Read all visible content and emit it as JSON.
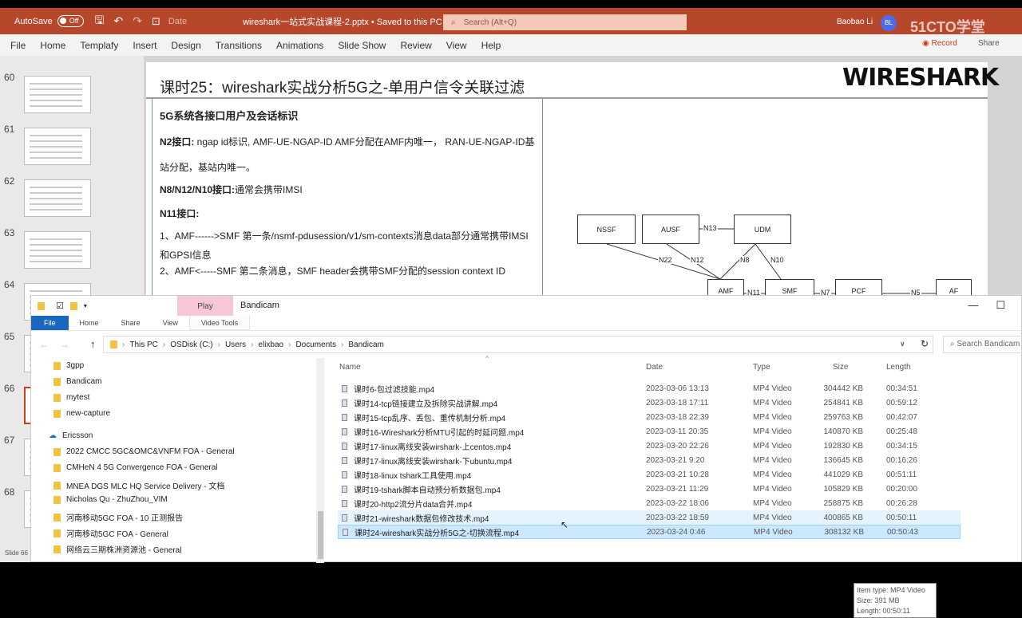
{
  "titlebar": {
    "autosave": "AutoSave",
    "toggle": "Off",
    "date_label": "Date",
    "doc_title": "wireshark一站式实战课程-2.pptx • Saved to this PC ∨",
    "search_placeholder": "Search (Alt+Q)",
    "user": "Baobao Li",
    "initials": "BL",
    "watermark": "51CTO学堂"
  },
  "ribbon": {
    "tabs": [
      "File",
      "Home",
      "Templafy",
      "Insert",
      "Design",
      "Transitions",
      "Animations",
      "Slide Show",
      "Review",
      "View",
      "Help"
    ],
    "record": "Record",
    "share": "Share"
  },
  "thumbnails": {
    "numbers": [
      "60",
      "61",
      "62",
      "63",
      "64",
      "65",
      "66",
      "67",
      "68"
    ],
    "selected": "66"
  },
  "slide": {
    "title": "课时25：wireshark实战分析5G之-单用户信令关联过滤",
    "logo": "WIRESHARK",
    "heading": "5G系统各接口用户及会话标识",
    "p1_bold": "N2接口:",
    "p1": " ngap id标识, AMF-UE-NGAP-ID AMF分配在AMF内唯一， RAN-UE-NGAP-ID基站分配，基站内唯一。",
    "p2_bold": "N8/N12/N10接口:",
    "p2": "通常会携带IMSI",
    "p3_bold": "N11接口:",
    "p4": "1、AMF------>SMF 第一条/nsmf-pdusession/v1/sm-contexts消息data部分通常携带IMSI和GPSI信息",
    "p5": "2、AMF<-----SMF 第二条消息，SMF header会携带SMF分配的session context ID",
    "diagram": {
      "nodes": [
        "NSSF",
        "AUSF",
        "UDM",
        "AMF",
        "SMF",
        "PCF",
        "AF"
      ],
      "links": [
        "N13",
        "N22",
        "N12",
        "N8",
        "N10",
        "N11",
        "N7",
        "N5"
      ]
    }
  },
  "explorer": {
    "play_tab": "Play",
    "title": "Bandicam",
    "tabs": [
      "File",
      "Home",
      "Share",
      "View",
      "Video Tools"
    ],
    "breadcrumb": [
      "This PC",
      "OSDisk (C:)",
      "Users",
      "elixbao",
      "Documents",
      "Bandicam"
    ],
    "search_placeholder": "Search Bandicam",
    "nav": {
      "folders": [
        "3gpp",
        "Bandicam",
        "mytest",
        "new-capture"
      ],
      "group": "Ericsson",
      "group_items": [
        "2022 CMCC 5GC&OMC&VNFM FOA - General",
        "CMHeN 4 5G Convergence FOA - General",
        "MNEA DGS MLC HQ Service Delivery - 文档",
        "Nicholas Qu - ZhuZhou_VIM",
        "河南移动5GC FOA - 10 正测报告",
        "河南移动5GC FOA - General",
        "网络云三期株洲资源池 - General"
      ]
    },
    "columns": [
      "Name",
      "Date",
      "Type",
      "Size",
      "Length"
    ],
    "files": [
      {
        "name": "课时6-包过滤技能.mp4",
        "date": "2023-03-06 13:13",
        "type": "MP4 Video",
        "size": "304442 KB",
        "length": "00:34:51"
      },
      {
        "name": "课时14-tcp链接建立及拆除实战讲解.mp4",
        "date": "2023-03-18 17:11",
        "type": "MP4 Video",
        "size": "254841 KB",
        "length": "00:59:12"
      },
      {
        "name": "课时15-tcp乱序、丢包、重传机制分析.mp4",
        "date": "2023-03-18 22:39",
        "type": "MP4 Video",
        "size": "259763 KB",
        "length": "00:42:07"
      },
      {
        "name": "课时16-Wireshark分析MTU引起的时延问题.mp4",
        "date": "2023-03-11 20:35",
        "type": "MP4 Video",
        "size": "140870 KB",
        "length": "00:25:48"
      },
      {
        "name": "课时17-linux离线安装wirshark-上centos.mp4",
        "date": "2023-03-20 22:26",
        "type": "MP4 Video",
        "size": "192830 KB",
        "length": "00:34:15"
      },
      {
        "name": "课时17-linux离线安装wirshark-下ubuntu.mp4",
        "date": "2023-03-21 9:20",
        "type": "MP4 Video",
        "size": "136645 KB",
        "length": "00:16:26"
      },
      {
        "name": "课时18-linux tshark工具使用.mp4",
        "date": "2023-03-21 10:28",
        "type": "MP4 Video",
        "size": "441029 KB",
        "length": "00:51:11"
      },
      {
        "name": "课时19-tshark脚本自动预分析数据包.mp4",
        "date": "2023-03-21 11:29",
        "type": "MP4 Video",
        "size": "105829 KB",
        "length": "00:20:00"
      },
      {
        "name": "课时20-http2流分片data合并.mp4",
        "date": "2023-03-22 18:06",
        "type": "MP4 Video",
        "size": "258875 KB",
        "length": "00:26:28"
      },
      {
        "name": "课时21-wireshark数据包修改技术.mp4",
        "date": "2023-03-22 18:59",
        "type": "MP4 Video",
        "size": "400865 KB",
        "length": "00:50:11"
      },
      {
        "name": "课时24-wireshark实战分析5G之-切换流程.mp4",
        "date": "2023-03-24 0:46",
        "type": "MP4 Video",
        "size": "308132 KB",
        "length": "00:50:43"
      }
    ],
    "tooltip": [
      "Item type: MP4 Video",
      "Size: 391 MB",
      "Length: 00:50:11"
    ]
  },
  "status": {
    "slide": "Slide 66"
  }
}
